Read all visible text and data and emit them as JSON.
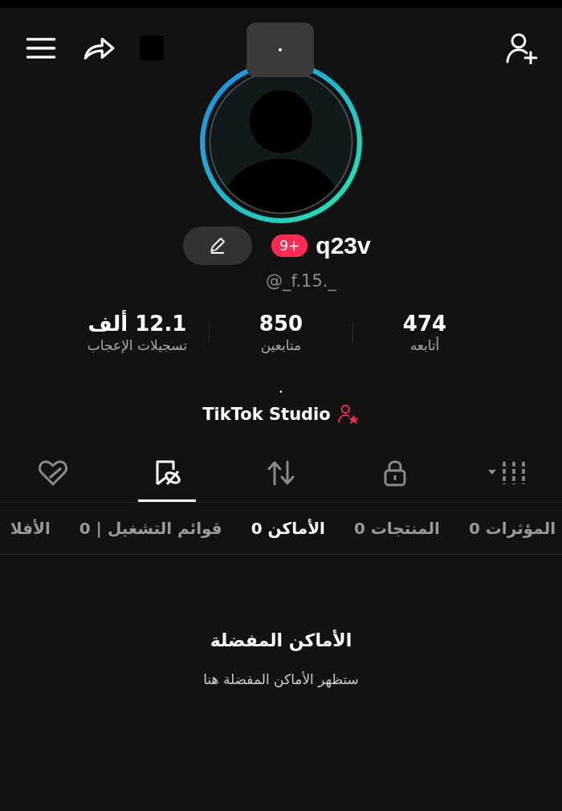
{
  "profile": {
    "name": "q23v",
    "badge": "9+",
    "handle": "@_f.15._",
    "bio": ".",
    "studio_link": "TikTok Studio"
  },
  "stats": [
    {
      "value": "474",
      "label": "أتابعه"
    },
    {
      "value": "850",
      "label": "متابعين"
    },
    {
      "value": "12.1 ألف",
      "label": "تسجيلات الإعجاب"
    }
  ],
  "content_tabs": [
    {
      "kind": "grid",
      "selected": false
    },
    {
      "kind": "lock",
      "selected": false
    },
    {
      "kind": "repost",
      "selected": false
    },
    {
      "kind": "saved",
      "selected": true
    },
    {
      "kind": "liked",
      "selected": false
    }
  ],
  "subtabs": [
    {
      "label": "المؤثرات 0",
      "selected": false
    },
    {
      "label": "المنتجات 0",
      "selected": false
    },
    {
      "label": "الأماكن 0",
      "selected": true
    },
    {
      "label": "قوائم التشغيل | 0",
      "selected": false
    },
    {
      "label": "الأفلا",
      "selected": false
    }
  ],
  "empty_state": {
    "title": "الأماكن المفضلة",
    "message": "ستظهر الأماكن المفضلة هنا"
  }
}
